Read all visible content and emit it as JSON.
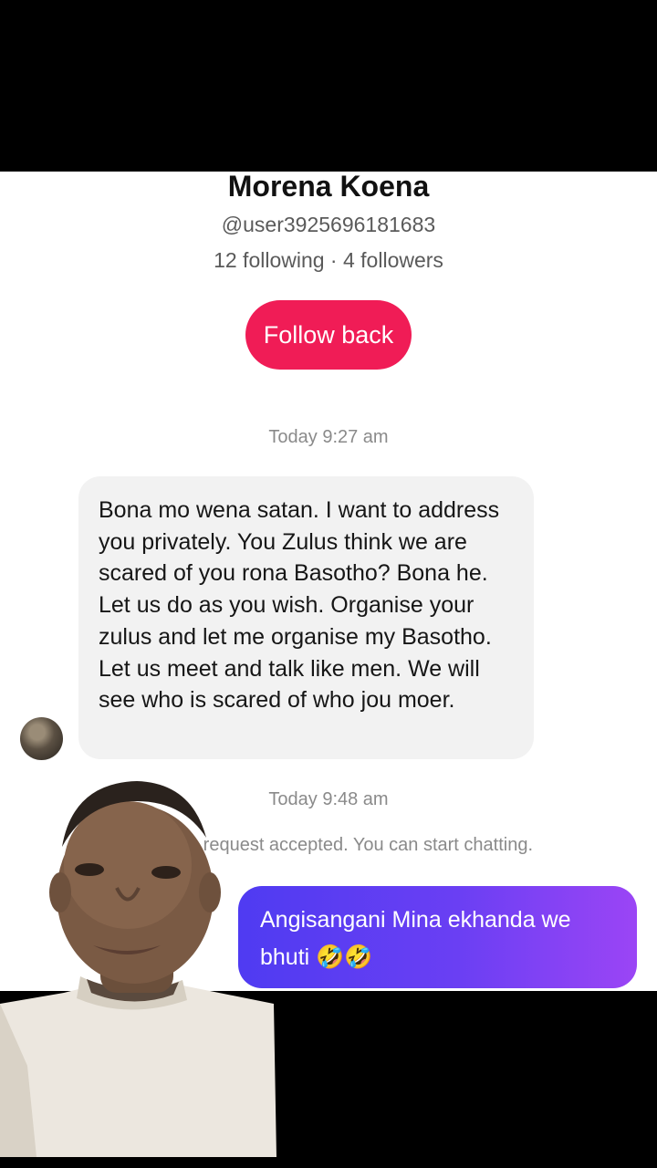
{
  "profile": {
    "name": "Morena Koena",
    "handle": "@user3925696181683",
    "stats": "12 following · 4 followers",
    "follow_label": "Follow back"
  },
  "chat": {
    "timestamp_1": "Today 9:27 am",
    "incoming_message": "Bona mo wena satan. I want to address you privately. You Zulus think we are scared of you rona Basotho? Bona he. Let us do as you wish. Organise your zulus and let me organise my Basotho. Let us meet and talk like men. We will see who is scared of who jou moer.",
    "timestamp_2": "Today 9:48 am",
    "system_note": "Message request accepted. You can start chatting.",
    "outgoing_message": "Angisangani Mina ekhanda we bhuti 🤣🤣"
  },
  "colors": {
    "follow_button": "#f01c56",
    "outgoing_bubble_start": "#4f3bf2",
    "outgoing_bubble_end": "#9b45f5",
    "incoming_bubble": "#f2f2f2"
  }
}
